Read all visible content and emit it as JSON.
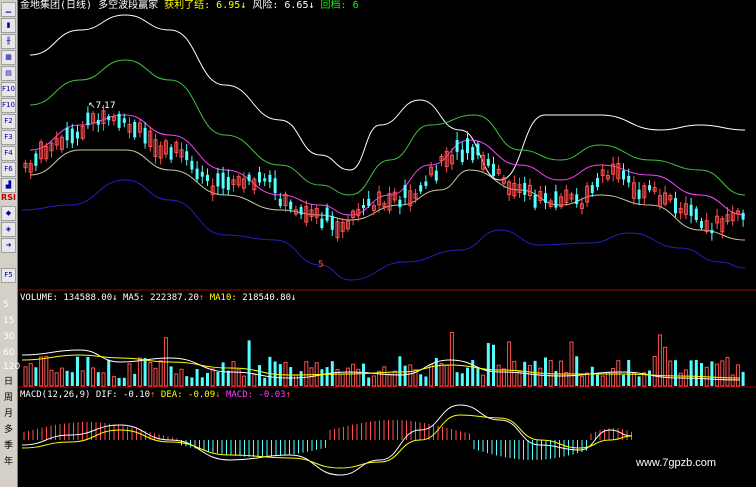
{
  "header": {
    "stock_name": "金地集团",
    "period": "(日线)",
    "indicator": "多空波段赢家",
    "profit_label": "获利了结:",
    "profit_value": "6.95",
    "profit_arrow": "↓",
    "risk_label": "风险:",
    "risk_value": "6.65",
    "risk_arrow": "↓",
    "pullback_label": "回档:",
    "pullback_value": "6"
  },
  "main_chart": {
    "high_marker": "7.17",
    "low_marker": "5"
  },
  "volume": {
    "label": "VOLUME:",
    "value": "134588.00",
    "value_arrow": "↓",
    "ma5_label": "MA5:",
    "ma5_value": "222387.20",
    "ma5_arrow": "↑",
    "ma10_label": "MA10:",
    "ma10_value": "218540.80",
    "ma10_arrow": "↓",
    "axis_ticks": [
      "5",
      "15",
      "30",
      "60",
      "120"
    ]
  },
  "macd": {
    "label": "MACD(12,26,9)",
    "dif_label": "DIF:",
    "dif_value": "-0.10",
    "dif_arrow": "↑",
    "dea_label": "DEA:",
    "dea_value": "-0.09",
    "dea_arrow": "↓",
    "macd_label": "MACD:",
    "macd_value": "-0.03",
    "macd_arrow": "↑"
  },
  "toolbar": {
    "icons": [
      "line-chart-icon",
      "candle-icon",
      "bar-icon",
      "grid-icon",
      "F10-icon",
      "window-icon",
      "F10b-icon",
      "f2-icon",
      "f3-icon",
      "f4-icon",
      "f5-icon",
      "f6-icon",
      "rsi-icon",
      "f8-icon",
      "arrow-icon",
      "f5b-icon"
    ],
    "labels": [
      "RSI",
      "F5"
    ],
    "period_buttons": [
      "日",
      "周",
      "月",
      "多",
      "季",
      "年"
    ]
  },
  "colors": {
    "up": "#ff5050",
    "down": "#54ffff",
    "white_line": "#ffffff",
    "green_line": "#40c040",
    "magenta_line": "#ff40ff",
    "blue_line": "#2020c0",
    "grey_line": "#c0c0c0",
    "profit_color": "#ffff00",
    "pullback_color": "#00ff00",
    "dea_color": "#ffff00",
    "macd_color": "#ff40ff"
  },
  "watermark": "www.7gpzb.com"
}
